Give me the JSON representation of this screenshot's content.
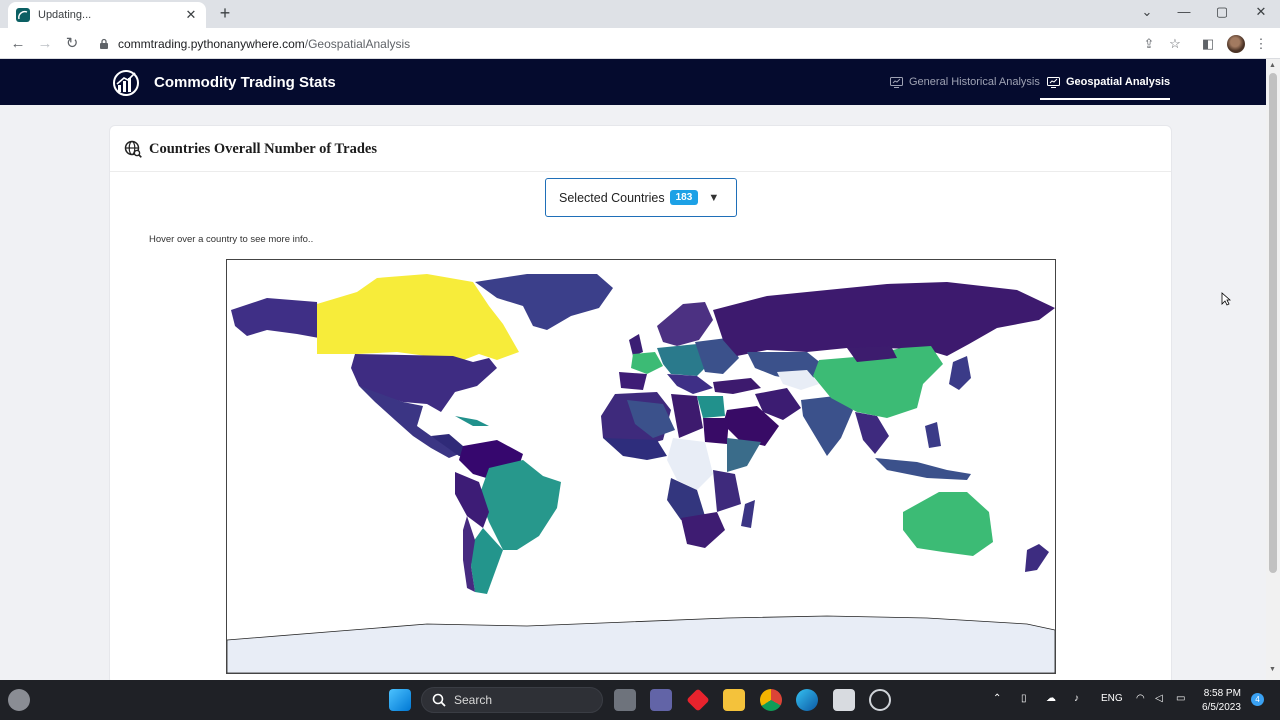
{
  "browser": {
    "tab_title": "Updating...",
    "url_host": "commtrading.pythonanywhere.com",
    "url_path": "/GeospatialAnalysis"
  },
  "app": {
    "brand": "Commodity Trading Stats",
    "nav": [
      {
        "label": "General Historical Analysis",
        "active": false
      },
      {
        "label": "Geospatial Analysis",
        "active": true
      }
    ]
  },
  "card": {
    "title": "Countries Overall Number of Trades",
    "dropdown_label": "Selected Countries",
    "dropdown_count": "183",
    "hover_hint": "Hover over a country to see more info.."
  },
  "map": {
    "colorscale": [
      "#440154",
      "#3b518b",
      "#21918c",
      "#3cbb75",
      "#fde725"
    ],
    "no_data_color": "#e8edf6"
  },
  "taskbar": {
    "search_label": "Search",
    "lang": "ENG",
    "time": "8:58 PM",
    "date": "6/5/2023",
    "notifications": "4"
  }
}
